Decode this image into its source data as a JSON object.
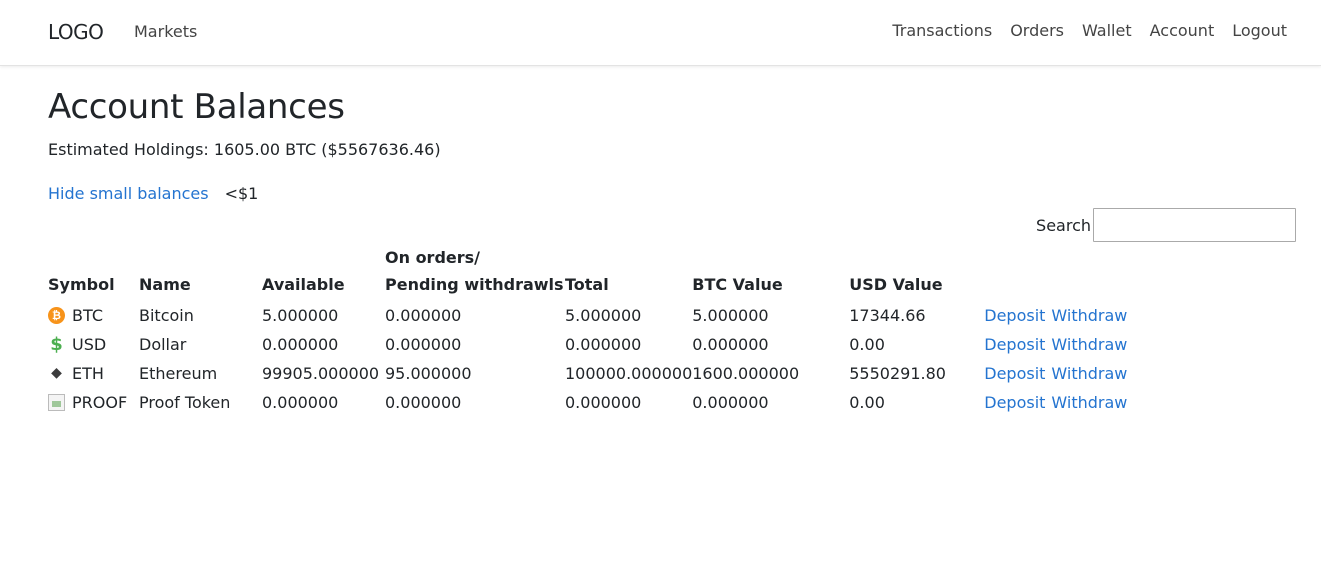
{
  "nav": {
    "brand": "LOGO",
    "left_items": [
      "Markets"
    ],
    "right_items": [
      "Transactions",
      "Orders",
      "Wallet",
      "Account",
      "Logout"
    ]
  },
  "page": {
    "title": "Account Balances",
    "holdings": "Estimated Holdings: 1605.00 BTC ($5567636.46)",
    "hide_small_label": "Hide small balances",
    "hide_small_threshold": "<$1"
  },
  "search": {
    "label": "Search",
    "value": "",
    "placeholder": ""
  },
  "table": {
    "headers": {
      "symbol": "Symbol",
      "name": "Name",
      "available": "Available",
      "orders_line1": "On orders/",
      "orders_line2": "Pending withdrawls",
      "total": "Total",
      "btc_value": "BTC Value",
      "usd_value": "USD Value"
    },
    "action_labels": {
      "deposit": "Deposit",
      "withdraw": "Withdraw"
    },
    "rows": [
      {
        "icon": "bitcoin-icon",
        "symbol": "BTC",
        "name": "Bitcoin",
        "available": "5.000000",
        "on_orders": "0.000000",
        "total": "5.000000",
        "btc_value": "5.000000",
        "usd_value": "17344.66"
      },
      {
        "icon": "dollar-icon",
        "symbol": "USD",
        "name": "Dollar",
        "available": "0.000000",
        "on_orders": "0.000000",
        "total": "0.000000",
        "btc_value": "0.000000",
        "usd_value": "0.00"
      },
      {
        "icon": "ethereum-icon",
        "symbol": "ETH",
        "name": "Ethereum",
        "available": "99905.000000",
        "on_orders": "95.000000",
        "total": "100000.000000",
        "btc_value": "1600.000000",
        "usd_value": "5550291.80"
      },
      {
        "icon": "broken-image-icon",
        "symbol": "PROOF",
        "name": "Proof Token",
        "available": "0.000000",
        "on_orders": "0.000000",
        "total": "0.000000",
        "btc_value": "0.000000",
        "usd_value": "0.00"
      }
    ]
  },
  "colors": {
    "link": "#2474d0",
    "text": "#212529",
    "btc_icon": "#f7931a",
    "usd_icon": "#4caf50",
    "eth_icon": "#3c3c3d"
  }
}
